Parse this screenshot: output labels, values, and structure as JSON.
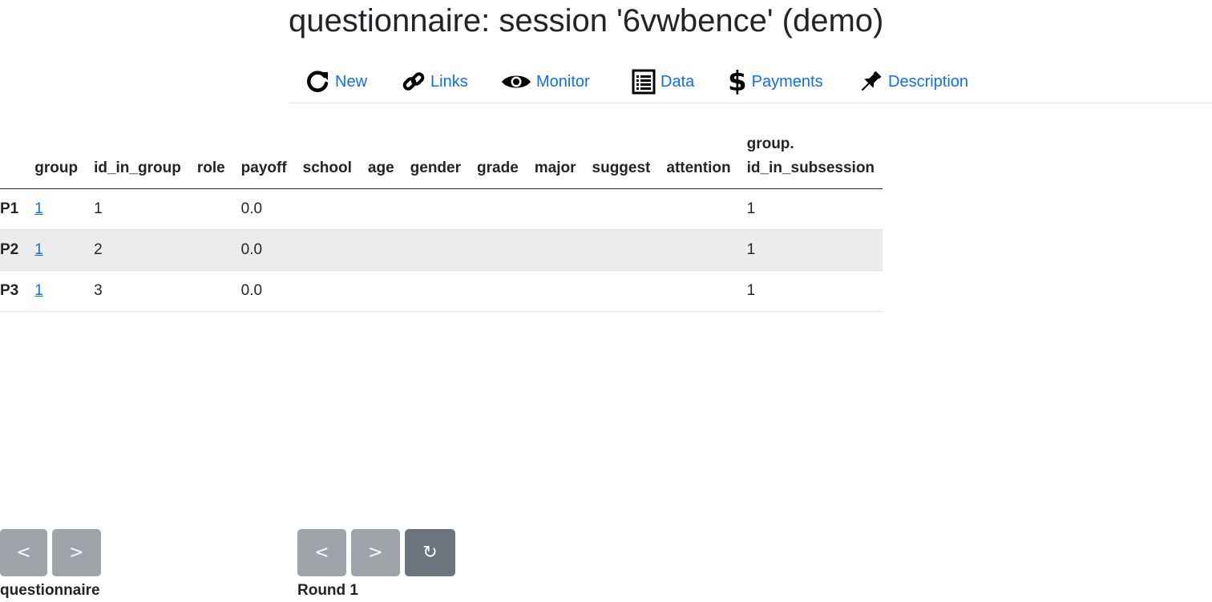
{
  "title": "questionnaire: session '6vwbence' (demo)",
  "nav": {
    "new": "New",
    "links": "Links",
    "monitor": "Monitor",
    "data": "Data",
    "payments": "Payments",
    "description": "Description"
  },
  "table": {
    "headers": [
      "group",
      "id_in_group",
      "role",
      "payoff",
      "school",
      "age",
      "gender",
      "grade",
      "major",
      "suggest",
      "attention"
    ],
    "last_header_line1": "group.",
    "last_header_line2": "id_in_subsession",
    "rows": [
      {
        "label": "P1",
        "group": "1",
        "id_in_group": "1",
        "role": "",
        "payoff": "0.0",
        "school": "",
        "age": "",
        "gender": "",
        "grade": "",
        "major": "",
        "suggest": "",
        "attention": "",
        "group_id_in_subsession": "1"
      },
      {
        "label": "P2",
        "group": "1",
        "id_in_group": "2",
        "role": "",
        "payoff": "0.0",
        "school": "",
        "age": "",
        "gender": "",
        "grade": "",
        "major": "",
        "suggest": "",
        "attention": "",
        "group_id_in_subsession": "1"
      },
      {
        "label": "P3",
        "group": "1",
        "id_in_group": "3",
        "role": "",
        "payoff": "0.0",
        "school": "",
        "age": "",
        "gender": "",
        "grade": "",
        "major": "",
        "suggest": "",
        "attention": "",
        "group_id_in_subsession": "1"
      }
    ]
  },
  "pager_app": {
    "prev": "<",
    "next": ">",
    "label": "questionnaire"
  },
  "pager_round": {
    "prev": "<",
    "next": ">",
    "refresh": "↻",
    "label": "Round 1"
  },
  "colors": {
    "link": "#0d6efd",
    "button": "#9fa4aa",
    "button_dark": "#6c757d",
    "stripe": "#ececec"
  }
}
